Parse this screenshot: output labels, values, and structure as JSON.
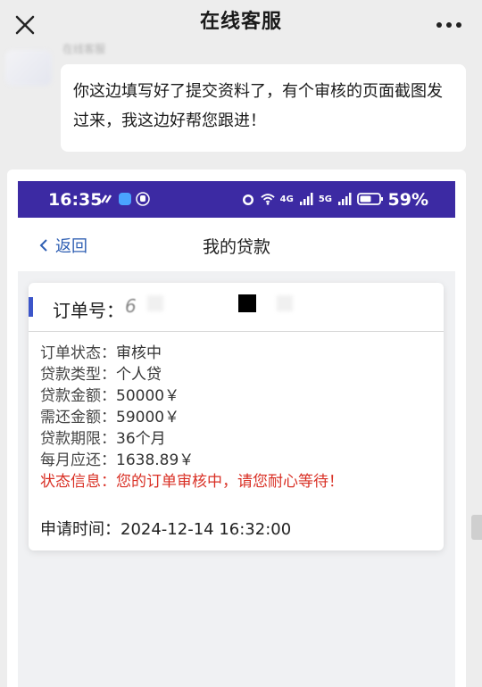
{
  "header": {
    "title": "在线客服"
  },
  "chat": {
    "sender_name": "在线客服",
    "message": "你这边填写好了提交资料了，有个审核的页面截图发过来，我这边好帮您跟进！"
  },
  "screenshot": {
    "status_bar": {
      "time": "16:35",
      "network_4g": "4G",
      "network_5g": "5G",
      "battery": "59%"
    },
    "app_bar": {
      "back_label": "返回",
      "title": "我的贷款"
    },
    "order": {
      "number_label": "订单号：",
      "number_value": "6",
      "details": [
        {
          "label": "订单状态：",
          "value": "审核中"
        },
        {
          "label": "贷款类型：",
          "value": "个人贷"
        },
        {
          "label": "贷款金额：",
          "value": "50000￥"
        },
        {
          "label": "需还金额：",
          "value": "59000￥"
        },
        {
          "label": "贷款期限：",
          "value": "36个月"
        },
        {
          "label": "每月应还：",
          "value": "1638.89￥"
        }
      ],
      "status_info": "状态信息：您的订单审核中，请您耐心等待！",
      "apply_time_label": "申请时间：",
      "apply_time_value": "2024-12-14 16:32:00"
    }
  },
  "colors": {
    "status_bar": "#3c2aa3",
    "accent_blue": "#2f5fb3",
    "status_red": "#d93025",
    "page_bg": "#ededed"
  },
  "icons": [
    "close-icon",
    "more-icon",
    "back-chevron-icon",
    "alarm-icon",
    "wifi-icon",
    "signal-icon",
    "battery-icon"
  ]
}
